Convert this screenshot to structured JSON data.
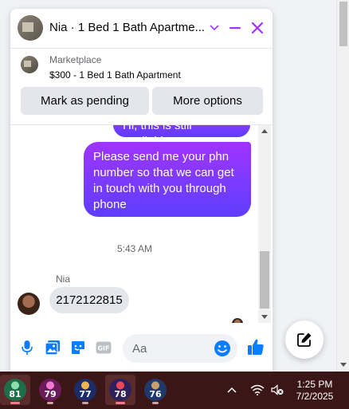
{
  "chat": {
    "title": "Nia · 1 Bed 1 Bath Apartme...",
    "product": {
      "source": "Marketplace",
      "listing": "$300 - 1 Bed 1 Bath Apartment",
      "pending_label": "Mark as pending",
      "more_label": "More options"
    },
    "messages": {
      "out_1": "Hi, this is still available",
      "out_2": "Please send me your phn number so that we can get in touch with you through phone",
      "timestamp": "5:43 AM",
      "sender": "Nia",
      "in_1": "2172122815"
    },
    "composer": {
      "placeholder": "Aa"
    }
  },
  "colors": {
    "accent": "#a033ff",
    "messenger_blue": "#0a7cff"
  },
  "taskbar": {
    "apps": [
      {
        "label": "81",
        "color": "#1f6e4a"
      },
      {
        "label": "79",
        "color": "#6b1b5a"
      },
      {
        "label": "77",
        "color": "#1b2c68"
      },
      {
        "label": "78",
        "color": "#2f1f5a"
      },
      {
        "label": "76",
        "color": "#1f3a6a"
      }
    ],
    "time": "1:25 PM",
    "date": "7/2/2025"
  }
}
